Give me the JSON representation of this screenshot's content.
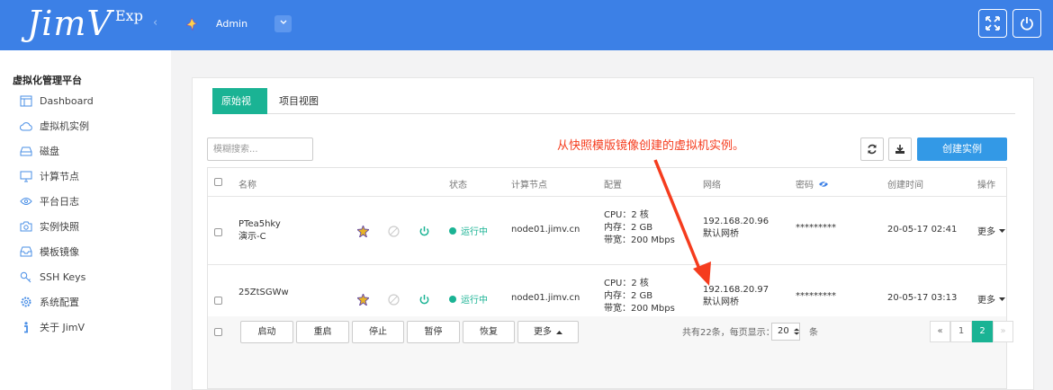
{
  "app": {
    "logo": "JimV",
    "logo_sup": "Exp",
    "collapse_glyph": "‹"
  },
  "header": {
    "user_name": "Admin"
  },
  "sidebar": {
    "title": "虚拟化管理平台",
    "items": [
      {
        "label": "Dashboard",
        "icon": "dashboard-icon"
      },
      {
        "label": "虚拟机实例",
        "icon": "cloud-icon"
      },
      {
        "label": "磁盘",
        "icon": "disk-icon"
      },
      {
        "label": "计算节点",
        "icon": "monitor-icon"
      },
      {
        "label": "平台日志",
        "icon": "eye-icon"
      },
      {
        "label": "实例快照",
        "icon": "camera-icon"
      },
      {
        "label": "模板镜像",
        "icon": "inbox-icon"
      },
      {
        "label": "SSH Keys",
        "icon": "key-icon"
      },
      {
        "label": "系统配置",
        "icon": "gear-icon"
      },
      {
        "label": "关于 JimV",
        "icon": "info-icon"
      }
    ]
  },
  "tabs": [
    "原始视图",
    "项目视图"
  ],
  "search": {
    "placeholder": "模糊搜索..."
  },
  "annotation": "从快照模版镜像创建的虚拟机实例。",
  "toolbar": {
    "create_label": "创建实例"
  },
  "table": {
    "headers": [
      "名称",
      "状态",
      "计算节点",
      "配置",
      "网络",
      "密码",
      "创建时间",
      "操作"
    ],
    "rows": [
      {
        "name": "PTea5hky",
        "sub": "演示-C",
        "status": "运行中",
        "node": "node01.jimv.cn",
        "cpu": "CPU：2 核",
        "mem": "内存：2 GB",
        "bw": "带宽：200 Mbps",
        "ip": "192.168.20.96",
        "bridge": "默认网桥",
        "password": "*********",
        "created": "20-05-17 02:41",
        "action": "更多"
      },
      {
        "name": "25ZtSGWw",
        "sub": "",
        "status": "运行中",
        "node": "node01.jimv.cn",
        "cpu": "CPU：2 核",
        "mem": "内存：2 GB",
        "bw": "带宽：200 Mbps",
        "ip": "192.168.20.97",
        "bridge": "默认网桥",
        "password": "*********",
        "created": "20-05-17 03:13",
        "action": "更多"
      }
    ]
  },
  "footer": {
    "buttons": [
      "启动",
      "重启",
      "停止",
      "暂停",
      "恢复",
      "更多"
    ],
    "total_prefix": "共有22条，每页显示：",
    "page_size": "20",
    "total_suffix": "条",
    "pages": [
      "«",
      "1",
      "2",
      "»"
    ]
  },
  "colors": {
    "header": "#3c80e6",
    "accent": "#1ab394",
    "create": "#3399e6",
    "annotation": "#f53c1e"
  }
}
